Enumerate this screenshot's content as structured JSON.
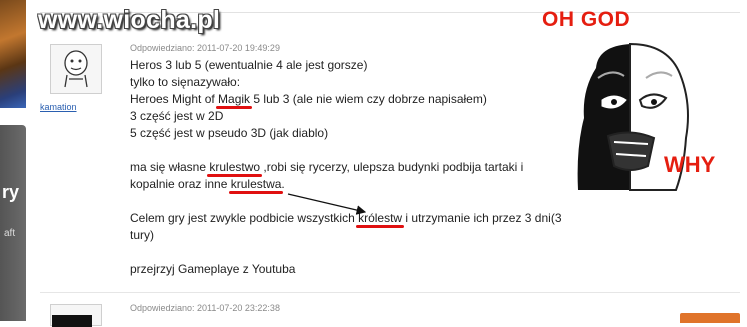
{
  "watermark": "www.wiocha.pl",
  "meme": {
    "top_text": "OH GOD",
    "bottom_text": "WHY",
    "accent_color": "#e51e10"
  },
  "sidebar": {
    "panel_text": "ry",
    "panel_small": "aft"
  },
  "post": {
    "author": "kamation",
    "meta": "Odpowiedziano: 2011-07-20 19:49:29",
    "lines": [
      "Heros 3 lub 5 (ewentualnie 4 ale jest gorsze)",
      "tylko to sięnazywało:",
      "Heroes Might of ",
      "Magik",
      " 5 lub 3 (ale nie wiem czy dobrze napisałem)",
      "3 część jest w 2D",
      "5 część jest w pseudo 3D (jak diablo)",
      "ma się własne ",
      "krulestwo",
      " ,robi się rycerzy, ulepsza budynki podbija tartaki i",
      "kopalnie oraz inne ",
      "krulestwa",
      ".",
      "Celem gry jest zwykle podbicie wszystkich ",
      "królestw",
      " i utrzymanie ich przez 3 dni(3",
      "tury)",
      "przejrzyj Gameplaye z Youtuba"
    ],
    "highlight_color": "#e01010"
  },
  "next_post": {
    "meta": "Odpowiedziano: 2011-07-20 23:22:38"
  }
}
